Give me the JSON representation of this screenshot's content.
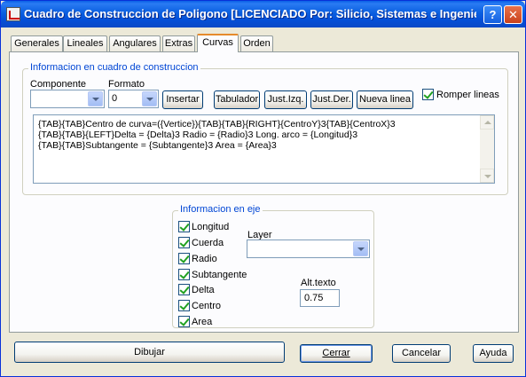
{
  "window": {
    "title": "Cuadro de Construccion de Poligono  [LICENCIADO Por: Silicio, Sistemas e Ingenie...",
    "help_label": "?",
    "close_label": "✕",
    "icon": "app-icon"
  },
  "tabs": [
    {
      "label": "Generales"
    },
    {
      "label": "Lineales"
    },
    {
      "label": "Angulares"
    },
    {
      "label": "Extras"
    },
    {
      "label": "Curvas",
      "active": true
    },
    {
      "label": "Orden"
    }
  ],
  "info_group": {
    "title": "Informacion en cuadro de construccion",
    "componente_label": "Componente",
    "componente_value": "",
    "formato_label": "Formato",
    "formato_value": "0",
    "buttons": {
      "insertar": "Insertar",
      "tabulador": "Tabulador",
      "just_izq": "Just.Izq.",
      "just_der": "Just.Der.",
      "nueva_linea": "Nueva linea"
    },
    "romper_lineas_label": "Romper lineas",
    "romper_lineas_checked": true,
    "template_lines": [
      "{TAB}{TAB}Centro de curva=({Vertice}){TAB}{TAB}{RIGHT}{CentroY}3{TAB}{CentroX}3",
      "{TAB}{TAB}{LEFT}Delta = {Delta}3   Radio = {Radio}3   Long. arco = {Longitud}3",
      "{TAB}{TAB}Subtangente = {Subtangente}3   Area = {Area}3"
    ]
  },
  "eje_group": {
    "title": "Informacion en eje",
    "checkboxes": [
      {
        "label": "Longitud",
        "checked": true
      },
      {
        "label": "Cuerda",
        "checked": true
      },
      {
        "label": "Radio",
        "checked": true
      },
      {
        "label": "Subtangente",
        "checked": true
      },
      {
        "label": "Delta",
        "checked": true
      },
      {
        "label": "Centro",
        "checked": true
      },
      {
        "label": "Area",
        "checked": true
      }
    ],
    "layer_label": "Layer",
    "layer_value": "",
    "alt_texto_label": "Alt.texto",
    "alt_texto_value": "0.75"
  },
  "footer": {
    "dibujar": "Dibujar",
    "cerrar": "Cerrar",
    "cancelar": "Cancelar",
    "ayuda": "Ayuda"
  },
  "colors": {
    "titlebar": "#0a5fe0",
    "group_label": "#0046d5",
    "active_tab_accent": "#e68b2c",
    "check_mark": "#21a121"
  }
}
